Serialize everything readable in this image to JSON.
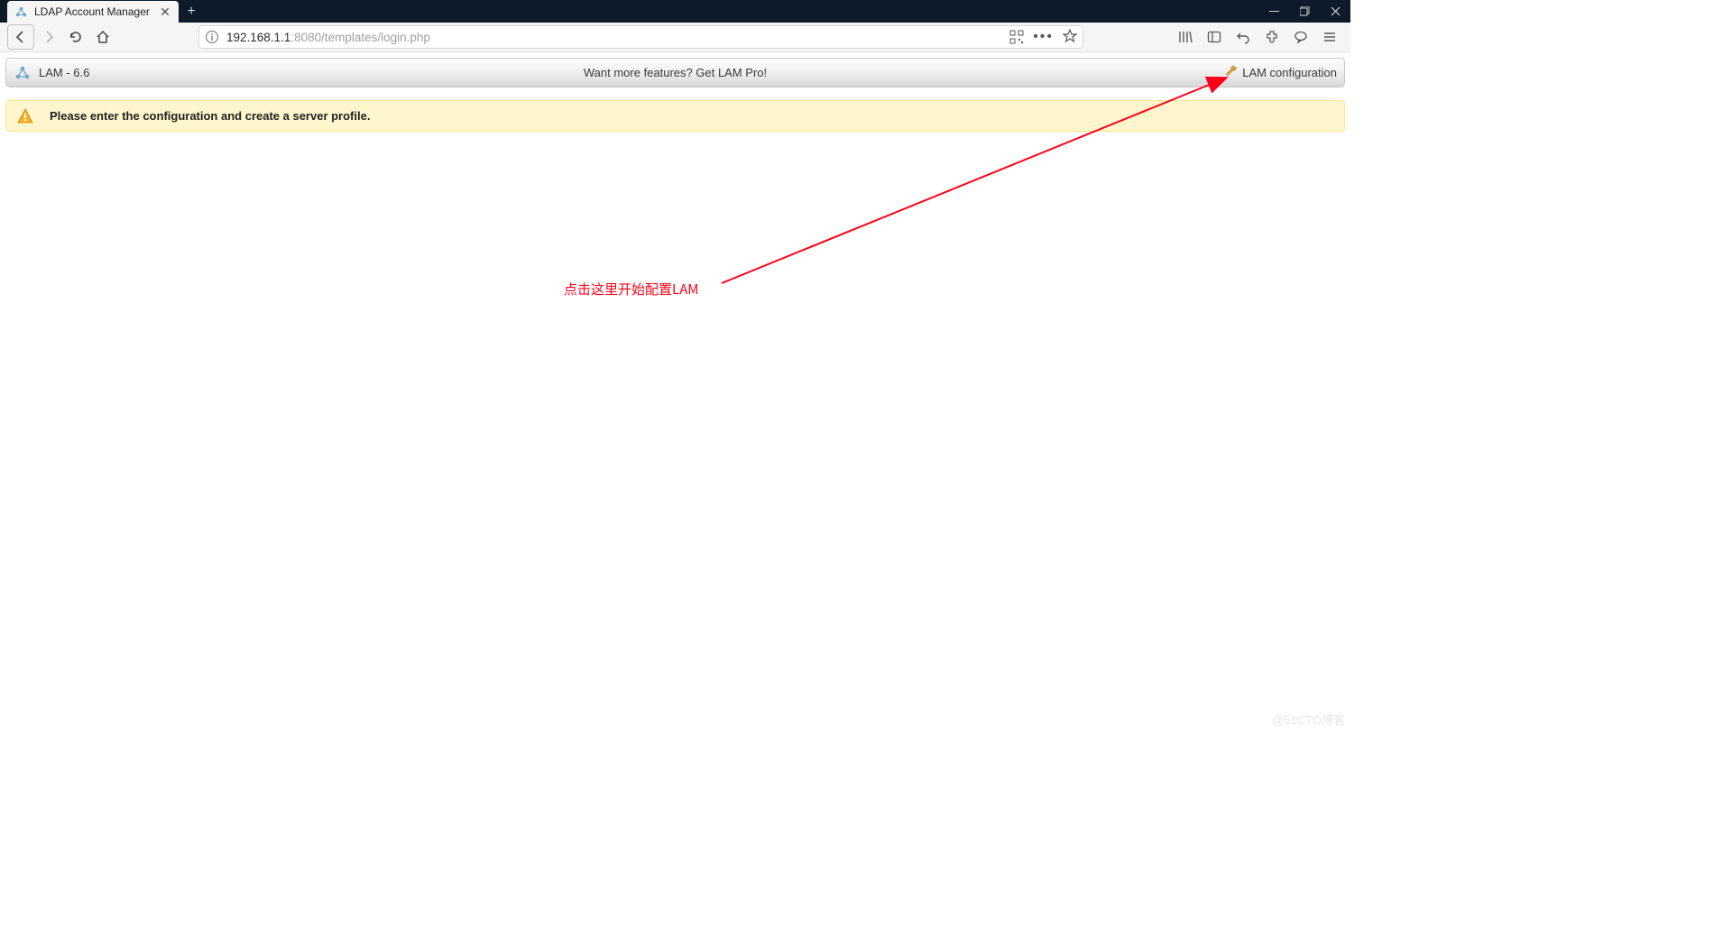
{
  "browser": {
    "tab_title": "LDAP Account Manager",
    "url_prefix": "192.168.1.1",
    "url_host": ":8080",
    "url_path": "/templates/login.php"
  },
  "lam": {
    "title": "LAM - 6.6",
    "promo": "Want more features? Get LAM Pro!",
    "config_link": "LAM configuration"
  },
  "warning": {
    "message": "Please enter the configuration and create a server profile."
  },
  "annotation": {
    "text": "点击这里开始配置LAM"
  },
  "watermark": "@51CTO博客"
}
